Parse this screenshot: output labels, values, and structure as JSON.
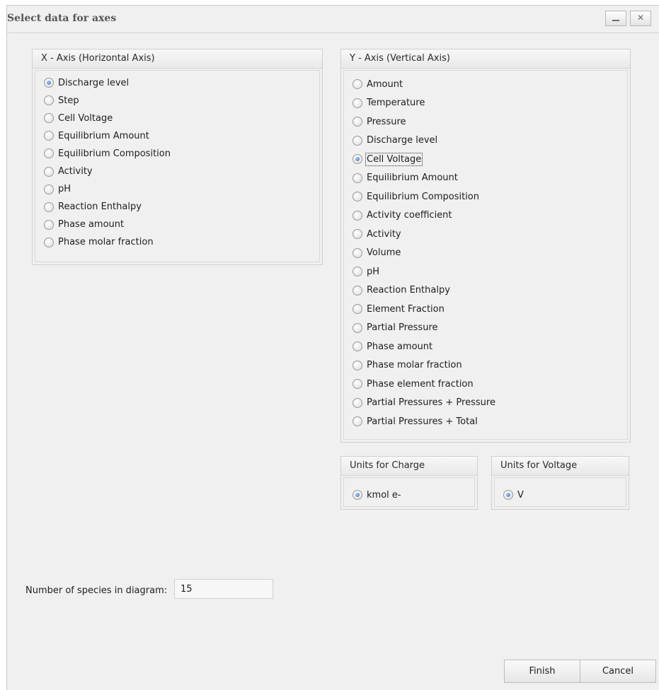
{
  "window": {
    "title": "Select data for axes"
  },
  "x_axis": {
    "header": "X - Axis (Horizontal Axis)",
    "options": [
      "Discharge level",
      "Step",
      "Cell Voltage",
      "Equilibrium Amount",
      "Equilibrium Composition",
      "Activity",
      "pH",
      "Reaction Enthalpy",
      "Phase amount",
      "Phase molar fraction"
    ],
    "selected": "Discharge level"
  },
  "y_axis": {
    "header": "Y - Axis (Vertical Axis)",
    "options": [
      "Amount",
      "Temperature",
      "Pressure",
      "Discharge level",
      "Cell Voltage",
      "Equilibrium Amount",
      "Equilibrium Composition",
      "Activity coefficient",
      "Activity",
      "Volume",
      "pH",
      "Reaction Enthalpy",
      "Element Fraction",
      "Partial Pressure",
      "Phase amount",
      "Phase molar fraction",
      "Phase element fraction",
      "Partial Pressures + Pressure",
      "Partial Pressures + Total"
    ],
    "selected": "Cell Voltage"
  },
  "units_charge": {
    "header": "Units for Charge",
    "option": "kmol e-"
  },
  "units_voltage": {
    "header": "Units for Voltage",
    "option": "V"
  },
  "species": {
    "label": "Number of species in diagram:",
    "value": "15"
  },
  "buttons": {
    "finish": "Finish",
    "cancel": "Cancel"
  },
  "colors": {
    "radio_selected": "#3d72c4",
    "background": "#f0f0f0"
  }
}
